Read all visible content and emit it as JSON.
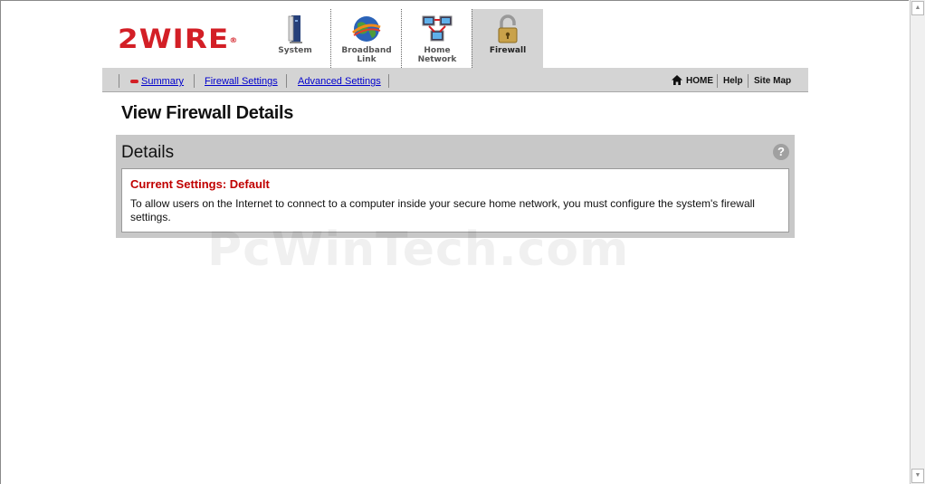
{
  "brand": {
    "logo_text": "2WIRE",
    "logo_mark": "®",
    "brand_color": "#d31f26"
  },
  "tabs": [
    {
      "label": "System",
      "icon": "system-tower-icon"
    },
    {
      "label": "Broadband",
      "label2": "Link",
      "icon": "globe-icon"
    },
    {
      "label": "Home",
      "label2": "Network",
      "icon": "computers-network-icon"
    },
    {
      "label": "Firewall",
      "icon": "padlock-icon",
      "active": true
    }
  ],
  "subnav": {
    "items": [
      "Summary",
      "Firewall Settings",
      "Advanced Settings"
    ],
    "right": {
      "home": "HOME",
      "help": "Help",
      "sitemap": "Site Map"
    }
  },
  "page": {
    "title": "View Firewall Details",
    "panel_title": "Details",
    "help_symbol": "?",
    "current_settings": "Current Settings: Default",
    "description": "To allow users on the Internet to connect to a computer inside your secure home network, you must configure the system's firewall settings."
  },
  "watermark": "PcWinTech.com",
  "colors": {
    "accent_red": "#c00000",
    "link_blue": "#0000cc",
    "panel_gray": "#c8c8c8"
  }
}
